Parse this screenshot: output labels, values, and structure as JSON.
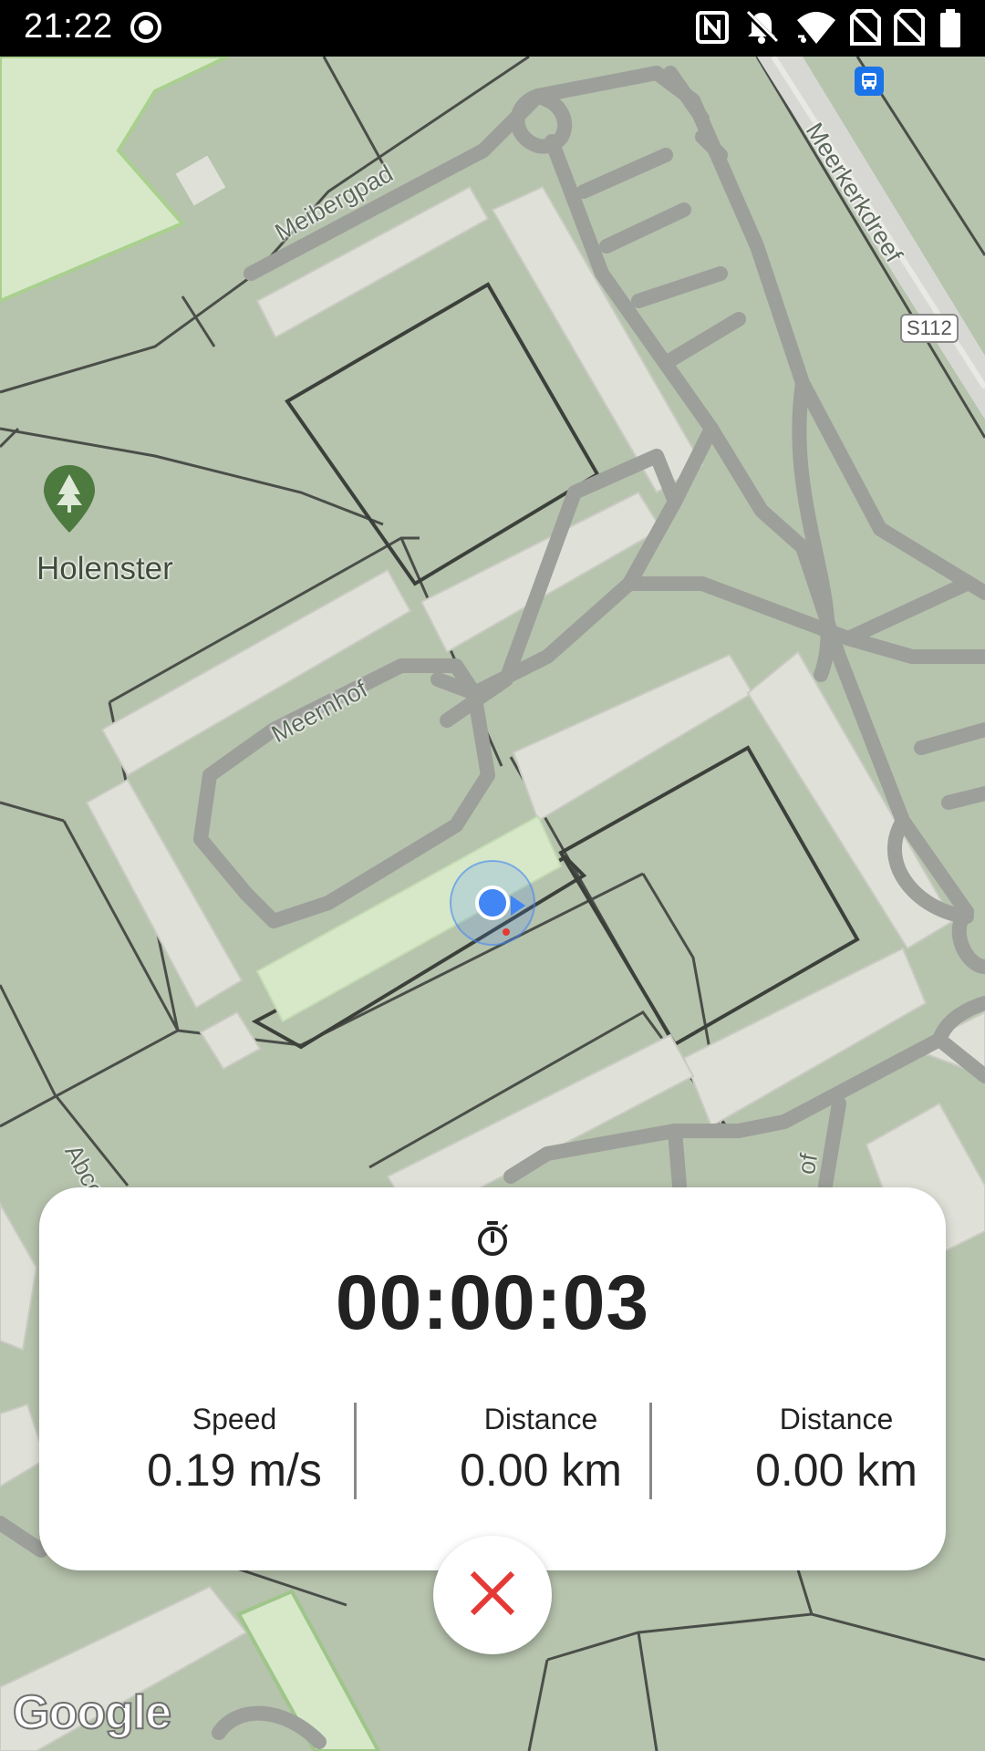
{
  "status_bar": {
    "time": "21:22",
    "icons": [
      "record-icon",
      "nfc-icon",
      "notifications-off-icon",
      "wifi-icon",
      "no-sim-icon",
      "no-sim-icon",
      "battery-icon"
    ]
  },
  "map": {
    "street_labels": [
      "Meibergpad",
      "Meerkerkdreef",
      "Meernhof",
      "Abcou",
      "of"
    ],
    "road_shield": "S112",
    "poi": {
      "name": "Holenster",
      "icon": "tree-icon"
    },
    "transit_icon": "bus-stop-icon",
    "attribution": "Google"
  },
  "stats": {
    "timer_icon": "stopwatch-icon",
    "elapsed": "00:00:03",
    "items": [
      {
        "label": "Speed",
        "value": "0.19 m/s"
      },
      {
        "label": "Distance",
        "value": "0.00 km"
      },
      {
        "label": "Distance",
        "value": "0.00 km"
      }
    ]
  },
  "stop_button": {
    "icon": "close-icon",
    "color": "#e53935"
  },
  "colors": {
    "map_background": "#b6c3ad",
    "buildings": "#dfe1d8",
    "roads": "#9d9f9a",
    "park": "#d6e8c8",
    "location_dot": "#4285f4"
  }
}
